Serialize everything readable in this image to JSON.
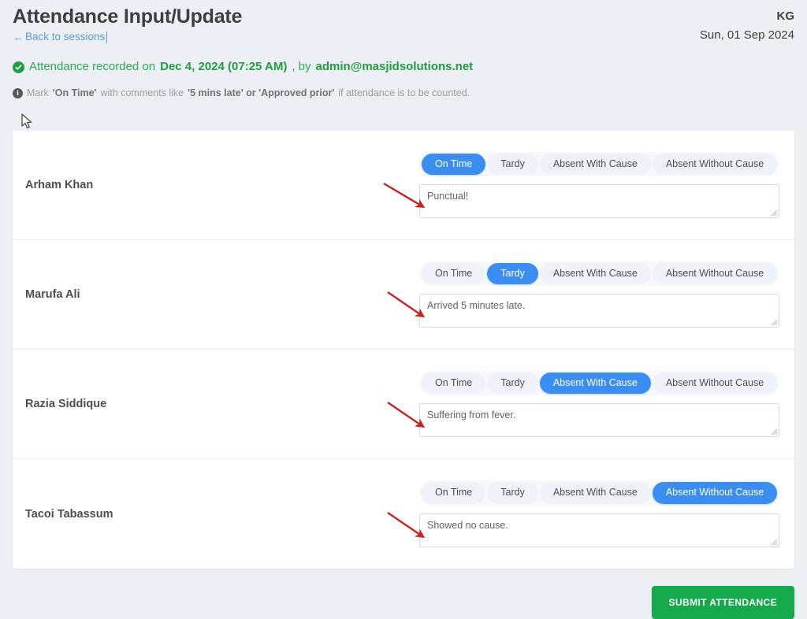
{
  "header": {
    "title": "Attendance Input/Update",
    "back_link": "Back to sessions",
    "back_icon": "arrow-left-icon",
    "class_code": "KG",
    "session_date": "Sun, 01 Sep 2024"
  },
  "notices": {
    "recorded": {
      "icon": "check-circle-icon",
      "prefix": "Attendance recorded on ",
      "datetime": "Dec 4, 2024 (07:25 AM)",
      "middle": ", by ",
      "user": "admin@masjidsolutions.net"
    },
    "hint": {
      "icon": "info-circle-icon",
      "part1": "Mark ",
      "bold1": "'On Time'",
      "part2": " with comments like ",
      "bold2": "'5 mins late' or 'Approved prior'",
      "part3": " if attendance is to be counted."
    }
  },
  "status_options": [
    "On Time",
    "Tardy",
    "Absent With Cause",
    "Absent Without Cause"
  ],
  "students": [
    {
      "name": "Arham Khan",
      "selected_status": "On Time",
      "comment": "Punctual!",
      "comment_placeholder": ""
    },
    {
      "name": "Marufa Ali",
      "selected_status": "Tardy",
      "comment": "Arrived 5 minutes late.",
      "comment_placeholder": ""
    },
    {
      "name": "Razia Siddique",
      "selected_status": "Absent With Cause",
      "comment": "Suffering from fever.",
      "comment_placeholder": ""
    },
    {
      "name": "Tacoi Tabassum",
      "selected_status": "Absent Without Cause",
      "comment": "Showed no cause.",
      "comment_placeholder": ""
    }
  ],
  "footer": {
    "submit_label": "SUBMIT ATTENDANCE"
  },
  "colors": {
    "page_background": "#eceff4",
    "accent_blue": "#3b8ef0",
    "link_blue": "#5b9bd5",
    "success_green": "#1f9d3f",
    "submit_green": "#14a94b",
    "annotation_red": "#c62222",
    "pill_idle": "#eff2f9"
  }
}
